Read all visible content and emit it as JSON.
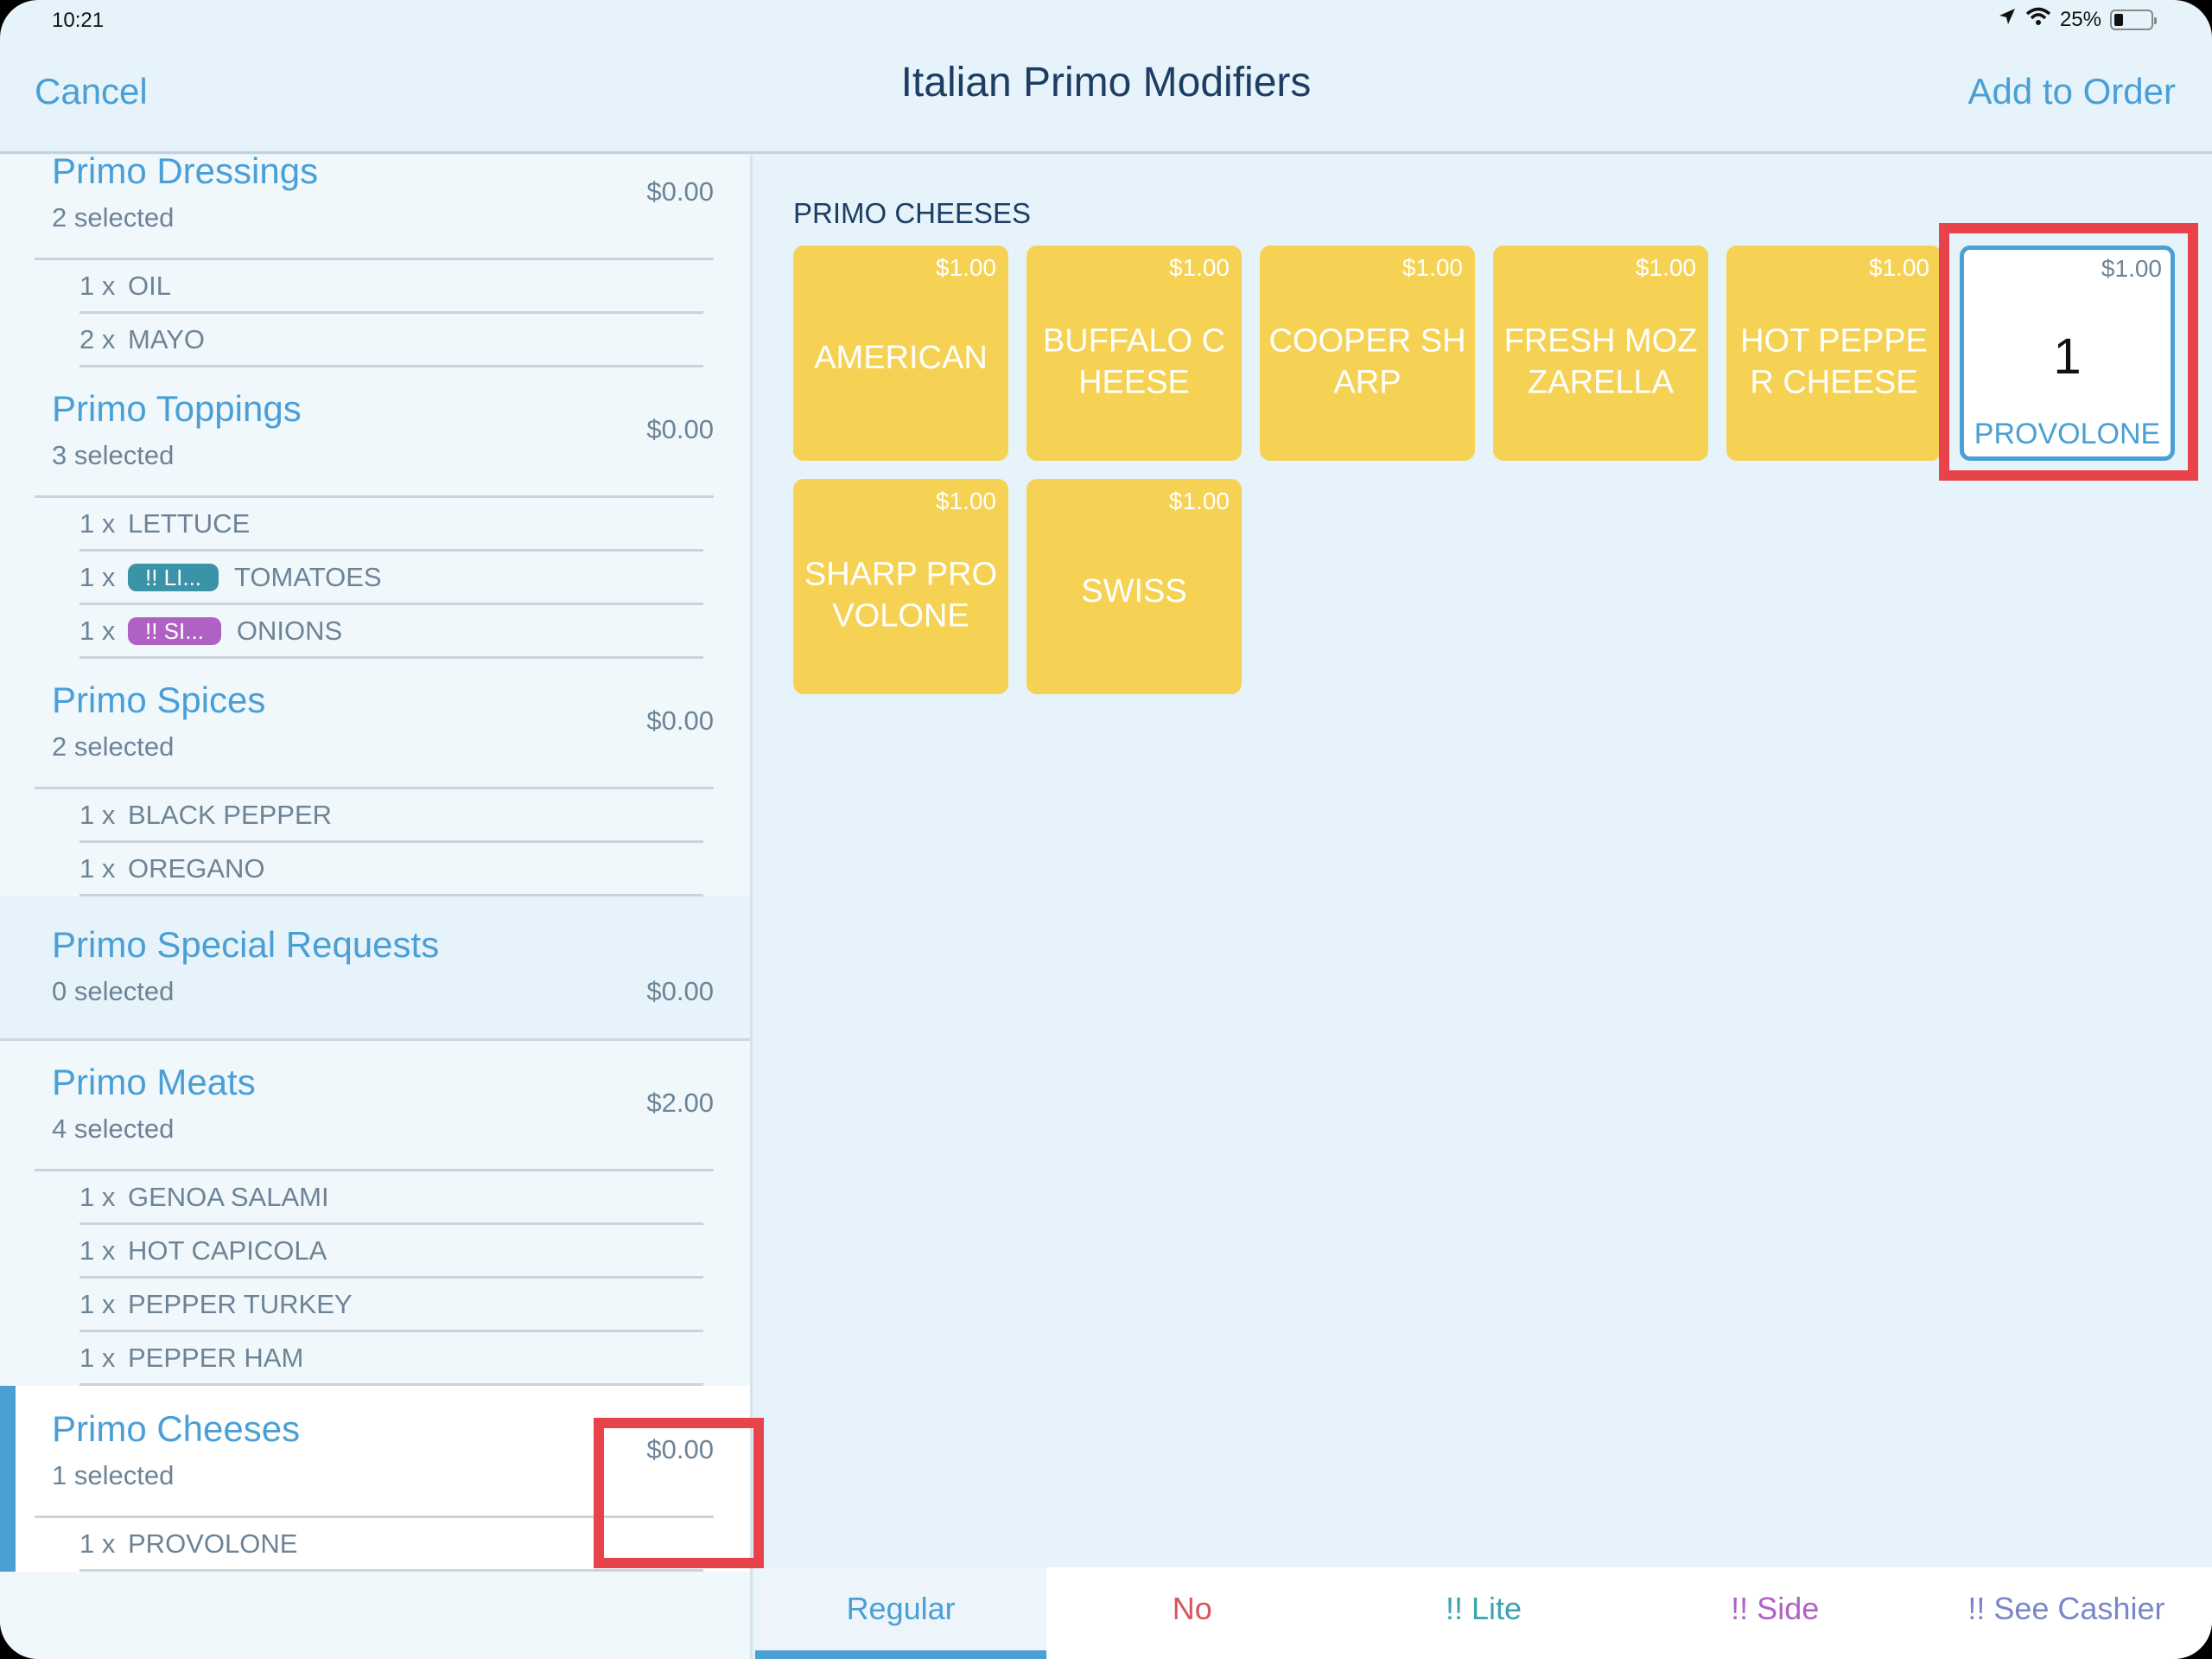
{
  "status_bar": {
    "time": "10:21",
    "battery_percent_label": "25%",
    "battery_level": 0.25,
    "icons": [
      "location-arrow-icon",
      "wifi-icon",
      "battery-icon"
    ]
  },
  "header": {
    "cancel_label": "Cancel",
    "title": "Italian Primo Modifiers",
    "add_to_order_label": "Add to Order"
  },
  "groups": [
    {
      "title": "Primo Dressings",
      "count": "2 selected",
      "price": "$0.00",
      "items": [
        {
          "qty": "1 x",
          "name": "OIL"
        },
        {
          "qty": "2 x",
          "name": "MAYO"
        }
      ]
    },
    {
      "title": "Primo Toppings",
      "count": "3 selected",
      "price": "$0.00",
      "items": [
        {
          "qty": "1 x",
          "name": "LETTUCE"
        },
        {
          "qty": "1 x",
          "badge": "!! LI...",
          "badge_color": "#3b93a8",
          "name": "TOMATOES"
        },
        {
          "qty": "1 x",
          "badge": "!! SI...",
          "badge_color": "#b061c4",
          "name": "ONIONS"
        }
      ]
    },
    {
      "title": "Primo Spices",
      "count": "2 selected",
      "price": "$0.00",
      "items": [
        {
          "qty": "1 x",
          "name": "BLACK PEPPER"
        },
        {
          "qty": "1 x",
          "name": "OREGANO"
        }
      ]
    },
    {
      "title": "Primo Special Requests",
      "count": "0 selected",
      "price": "$0.00",
      "items": []
    },
    {
      "title": "Primo Meats",
      "count": "4 selected",
      "price": "$2.00",
      "items": [
        {
          "qty": "1 x",
          "name": "GENOA SALAMI"
        },
        {
          "qty": "1 x",
          "name": "HOT CAPICOLA"
        },
        {
          "qty": "1 x",
          "name": "PEPPER TURKEY"
        },
        {
          "qty": "1 x",
          "name": "PEPPER HAM"
        }
      ]
    },
    {
      "title": "Primo Cheeses",
      "count": "1 selected",
      "price": "$0.00",
      "active": true,
      "items": [
        {
          "qty": "1 x",
          "name": "PROVOLONE"
        }
      ]
    }
  ],
  "main": {
    "section_label": "PRIMO CHEESES",
    "tiles": [
      {
        "name": "AMERICAN",
        "price": "$1.00"
      },
      {
        "name": "BUFFALO CHEESE",
        "price": "$1.00"
      },
      {
        "name": "COOPER SHARP",
        "price": "$1.00"
      },
      {
        "name": "FRESH MOZZARELLA",
        "price": "$1.00"
      },
      {
        "name": "HOT PEPPER CHEESE",
        "price": "$1.00"
      },
      {
        "name": "PROVOLONE",
        "price": "$1.00",
        "selected": true,
        "qty": "1"
      },
      {
        "name": "SHARP PROVOLONE",
        "price": "$1.00"
      },
      {
        "name": "SWISS",
        "price": "$1.00"
      }
    ]
  },
  "tabs": [
    {
      "label": "Regular",
      "color": "#4a9fd5",
      "active": true
    },
    {
      "label": "No",
      "color": "#d9545c"
    },
    {
      "label": "!! Lite",
      "color": "#3aa3ad"
    },
    {
      "label": "!! Side",
      "color": "#b061c4"
    },
    {
      "label": "!! See Cashier",
      "color": "#7b86c8"
    }
  ],
  "colors": {
    "accent": "#4a9fd5",
    "tile": "#f6d254",
    "highlight": "#e8434a",
    "title": "#1d3d63"
  }
}
